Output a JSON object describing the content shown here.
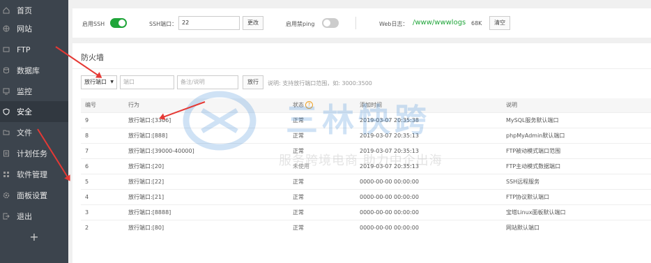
{
  "sidebar": {
    "items": [
      {
        "label": "首页",
        "icon": "home-icon"
      },
      {
        "label": "网站",
        "icon": "globe-icon"
      },
      {
        "label": "FTP",
        "icon": "ftp-icon"
      },
      {
        "label": "数据库",
        "icon": "database-icon"
      },
      {
        "label": "监控",
        "icon": "monitor-icon"
      },
      {
        "label": "安全",
        "icon": "shield-icon",
        "active": true
      },
      {
        "label": "文件",
        "icon": "folder-icon"
      },
      {
        "label": "计划任务",
        "icon": "task-icon"
      },
      {
        "label": "软件管理",
        "icon": "apps-icon"
      },
      {
        "label": "面板设置",
        "icon": "settings-icon"
      },
      {
        "label": "退出",
        "icon": "logout-icon"
      }
    ],
    "add_label": "+"
  },
  "top": {
    "ssh_label": "启用SSH",
    "ssh_enabled": true,
    "port_label": "SSH端口：",
    "port_value": "22",
    "change_btn": "更改",
    "ping_label": "启用禁ping",
    "ping_enabled": false,
    "weblog_label": "Web日志：",
    "weblog_path": "/www/wwwlogs",
    "weblog_size": "68K",
    "clear_btn": "清空"
  },
  "firewall": {
    "title": "防火墙",
    "select_value": "放行端口",
    "port_placeholder": "端口",
    "note_placeholder": "备注/说明",
    "submit_btn": "放行",
    "hint": "说明: 支持放行端口范围，如: 3000:3500",
    "columns": [
      "编号",
      "行为",
      "状态",
      "添加时间",
      "说明"
    ],
    "rows": [
      {
        "id": "9",
        "action": "放行端口:[3306]",
        "status": "正常",
        "time": "2019-03-07 20:35:38",
        "note": "MySQL服务默认端口"
      },
      {
        "id": "8",
        "action": "放行端口:[888]",
        "status": "正常",
        "time": "2019-03-07 20:35:13",
        "note": "phpMyAdmin默认端口"
      },
      {
        "id": "7",
        "action": "放行端口:[39000-40000]",
        "status": "正常",
        "time": "2019-03-07 20:35:13",
        "note": "FTP被动模式端口范围"
      },
      {
        "id": "6",
        "action": "放行端口:[20]",
        "status": "未使用",
        "time": "2019-03-07 20:35:13",
        "note": "FTP主动模式数据端口"
      },
      {
        "id": "5",
        "action": "放行端口:[22]",
        "status": "正常",
        "time": "0000-00-00 00:00:00",
        "note": "SSH远程服务"
      },
      {
        "id": "4",
        "action": "放行端口:[21]",
        "status": "正常",
        "time": "0000-00-00 00:00:00",
        "note": "FTP协议默认端口"
      },
      {
        "id": "3",
        "action": "放行端口:[8888]",
        "status": "正常",
        "time": "0000-00-00 00:00:00",
        "note": "宝塔Linux面板默认端口"
      },
      {
        "id": "2",
        "action": "放行端口:[80]",
        "status": "正常",
        "time": "0000-00-00 00:00:00",
        "note": "网站默认端口"
      }
    ]
  },
  "watermark": {
    "line1": "三林快跨",
    "line2": "服务跨境电商 助力中企出海"
  },
  "colors": {
    "accent": "#20a53a",
    "sidebar": "#3c444d",
    "arrow": "#e53935"
  }
}
